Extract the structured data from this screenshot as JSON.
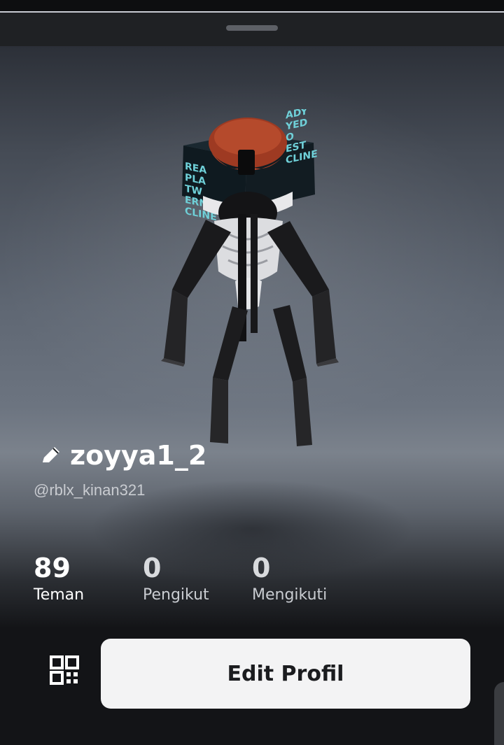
{
  "profile": {
    "display_name": "zoyya1_2",
    "username": "@rblx_kinan321"
  },
  "stats": [
    {
      "value": "89",
      "label": "Teman"
    },
    {
      "value": "0",
      "label": "Pengikut"
    },
    {
      "value": "0",
      "label": "Mengikuti"
    }
  ],
  "actions": {
    "edit_label": "Edit Profil"
  },
  "avatar": {
    "hat_text_left": [
      "REA",
      "PLA",
      "TW",
      "ERNI",
      "CLINE"
    ],
    "hat_text_right": [
      "ADY",
      "YED",
      "O",
      "EST",
      "CLINE"
    ]
  },
  "icons": {
    "edit": "pencil-icon",
    "qr": "qr-code-icon"
  },
  "colors": {
    "background": "#131417",
    "button": "#f3f3f4",
    "text_primary": "#ffffff"
  }
}
